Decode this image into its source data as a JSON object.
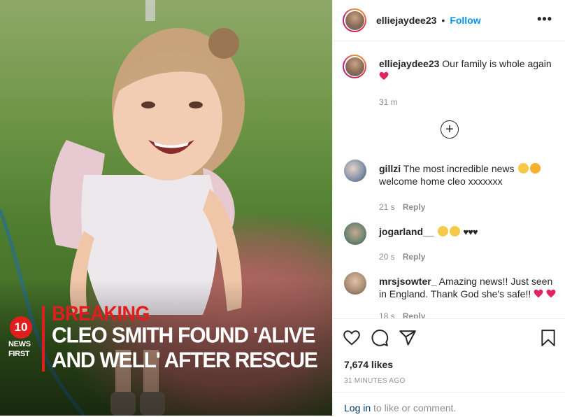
{
  "post": {
    "username": "elliejaydee23",
    "follow_label": "Follow",
    "more_label": "•••"
  },
  "overlay": {
    "logo_number": "10",
    "logo_line1": "NEWS",
    "logo_line2": "FIRST",
    "breaking": "BREAKING",
    "headline_line1": "CLEO SMITH FOUND 'ALIVE",
    "headline_line2": "AND WELL' AFTER RESCUE"
  },
  "caption": {
    "username": "elliejaydee23",
    "text": "Our family is whole again",
    "time": "31 m"
  },
  "comments": [
    {
      "username": "gillzi",
      "text": "The most incredible news",
      "text2": "welcome home cleo xxxxxxx",
      "time": "21 s",
      "reply": "Reply"
    },
    {
      "username": "jogarland__",
      "text": "",
      "time": "20 s",
      "reply": "Reply"
    },
    {
      "username": "mrsjsowter_",
      "text": "Amazing news!! Just seen in England. Thank God she's safe!!",
      "time": "18 s",
      "reply": "Reply"
    }
  ],
  "likes": "7,674 likes",
  "timestamp": "31 MINUTES AGO",
  "login": {
    "link": "Log in",
    "rest": " to like or comment."
  },
  "colors": {
    "accent": "#0095f6",
    "breaking_red": "#e21d1d",
    "heart_red": "#ed4956"
  }
}
